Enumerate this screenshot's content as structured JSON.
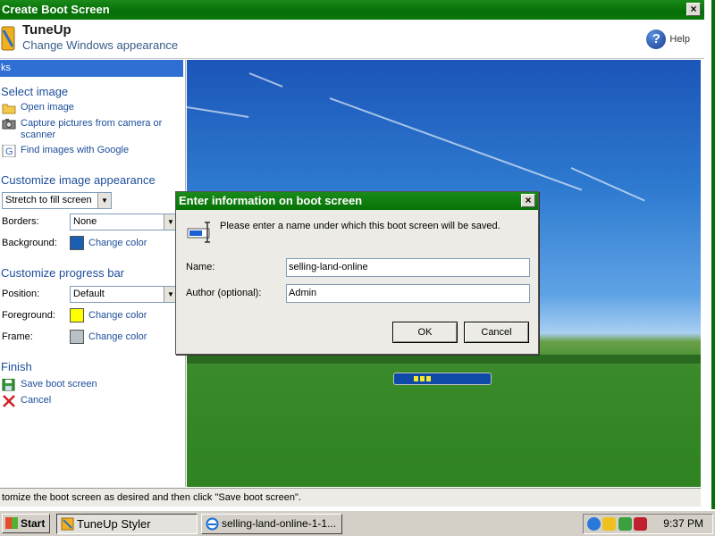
{
  "window": {
    "title": "Create Boot Screen",
    "close_glyph": "×"
  },
  "header": {
    "app_name": "TuneUp",
    "subtitle": "Change Windows appearance",
    "help_label": "Help",
    "help_glyph": "?"
  },
  "sidebar": {
    "tasks_label": "ks",
    "select_image": {
      "title": "Select image",
      "links": [
        "Open image",
        "Capture pictures from camera or scanner",
        "Find images with Google"
      ]
    },
    "appearance": {
      "title": "Customize image appearance",
      "stretch_value": "Stretch to fill screen",
      "borders_label": "Borders:",
      "borders_value": "None",
      "background_label": "Background:",
      "background_color": "#1a5fb4",
      "change_color_label": "Change color"
    },
    "progress": {
      "title": "Customize progress bar",
      "position_label": "Position:",
      "position_value": "Default",
      "foreground_label": "Foreground:",
      "foreground_color": "#ffff00",
      "frame_label": "Frame:",
      "frame_color": "#b8c0c8",
      "change_color_label": "Change color"
    },
    "finish": {
      "title": "Finish",
      "save_label": "Save boot screen",
      "cancel_label": "Cancel"
    }
  },
  "status": {
    "text": "tomize the boot screen as desired and then click \"Save boot screen\"."
  },
  "dialog": {
    "title": "Enter information on boot screen",
    "close_glyph": "×",
    "message": "Please enter a name under which this boot screen will be saved.",
    "name_label": "Name:",
    "name_value": "selling-land-online",
    "author_label": "Author (optional):",
    "author_value": "Admin",
    "ok_label": "OK",
    "cancel_label": "Cancel"
  },
  "taskbar": {
    "start_label": "Start",
    "tasks": [
      "TuneUp Styler",
      "selling-land-online-1-1..."
    ],
    "clock": "9:37 PM"
  },
  "colors": {
    "title_green": "#0b7a0b",
    "link_blue": "#1c4d9a",
    "tasks_bar": "#2f6fd4"
  }
}
